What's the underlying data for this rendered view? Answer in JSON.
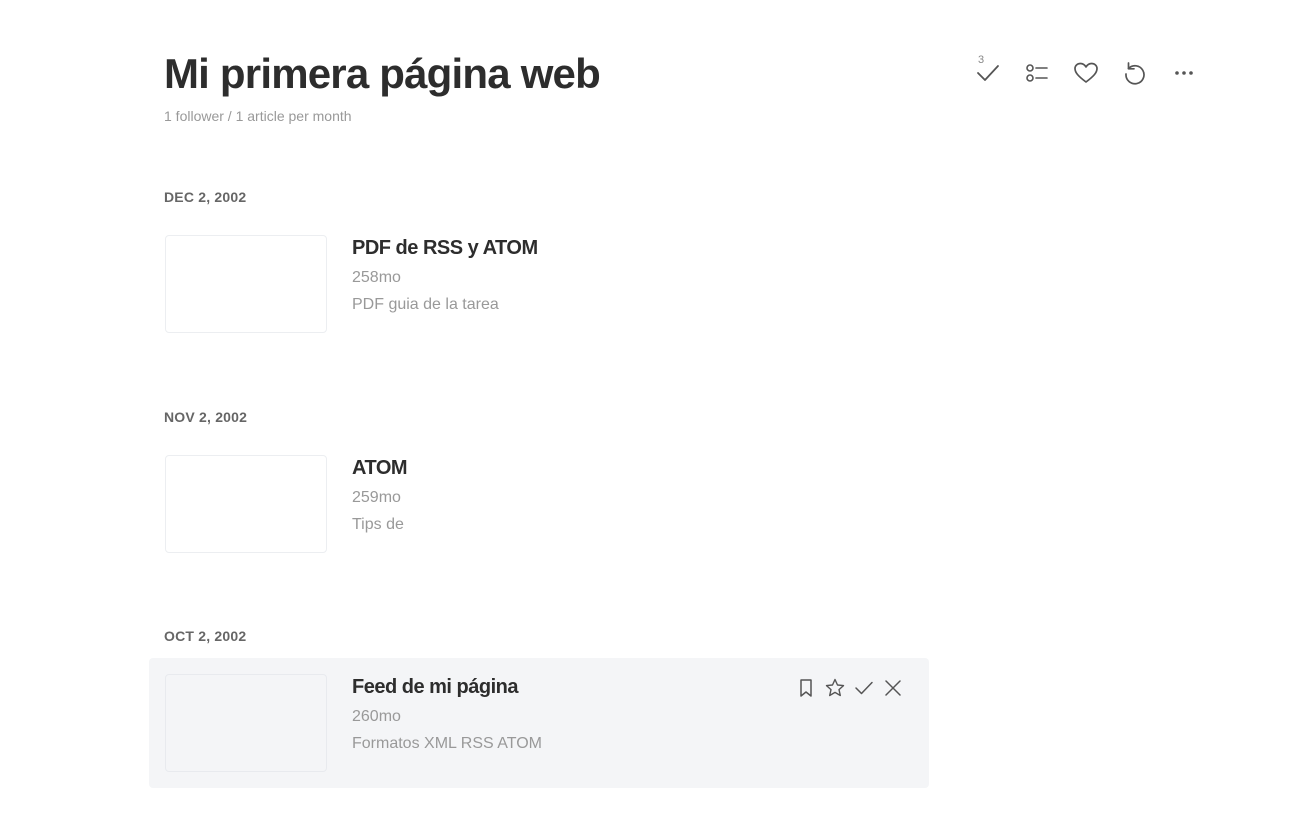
{
  "feed": {
    "title": "Mi primera página web",
    "subtitle": "1 follower / 1 article per month"
  },
  "toolbar": {
    "mark_read_count": "3",
    "icons": [
      "check-icon",
      "list-view-icon",
      "heart-icon",
      "refresh-icon",
      "more-icon"
    ]
  },
  "sections": [
    {
      "date": "DEC 2, 2002",
      "entry": {
        "title": "PDF de RSS y ATOM",
        "age": "258mo",
        "summary": "PDF guia de la tarea"
      }
    },
    {
      "date": "NOV 2, 2002",
      "entry": {
        "title": "ATOM",
        "age": "259mo",
        "summary": "Tips de"
      }
    },
    {
      "date": "OCT 2, 2002",
      "entry": {
        "title": "Feed de mi página",
        "age": "260mo",
        "summary": "Formatos XML RSS ATOM"
      }
    }
  ],
  "entry_actions": [
    "bookmark-icon",
    "star-icon",
    "check-icon",
    "close-icon"
  ],
  "colors": {
    "title": "#2d2d2d",
    "muted": "#999999",
    "hover_bg": "#f4f5f7",
    "icon": "#555555"
  }
}
